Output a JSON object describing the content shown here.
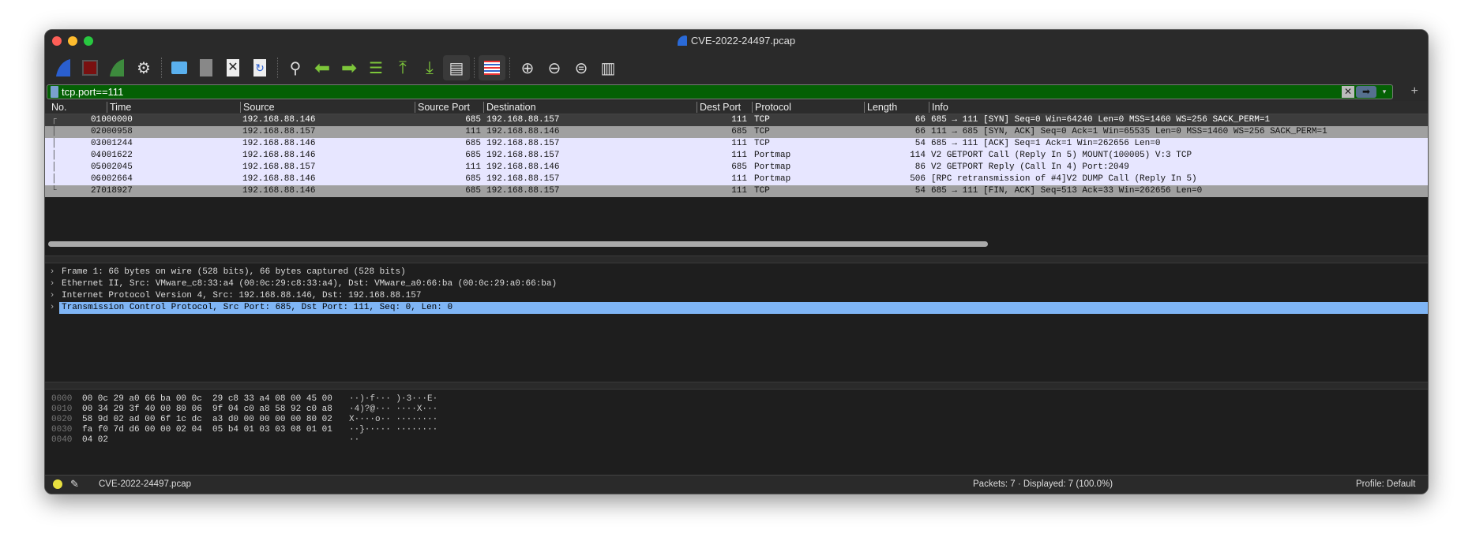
{
  "window": {
    "title": "CVE-2022-24497.pcap"
  },
  "toolbar": [
    "start-capture",
    "stop-capture",
    "restart-capture",
    "capture-options",
    "open-file",
    "save-file",
    "close-file",
    "reload-file",
    "find-packet",
    "go-back",
    "go-forward",
    "go-to-packet",
    "go-first",
    "go-last",
    "autoscroll",
    "colorize",
    "zoom-in",
    "zoom-out",
    "zoom-normal",
    "resize-columns"
  ],
  "filter": {
    "value": "tcp.port==111",
    "clear": "✕",
    "apply": "➡",
    "dropdown": "▾",
    "add": "+"
  },
  "columns": [
    "No.",
    "Time",
    "Source",
    "Source Port",
    "Destination",
    "Dest Port",
    "Protocol",
    "Length",
    "Info"
  ],
  "packets": [
    {
      "no": "1",
      "time": "0.000000",
      "src": "192.168.88.146",
      "sport": "685",
      "dst": "192.168.88.157",
      "dport": "111",
      "proto": "TCP",
      "len": "66",
      "info": "685 → 111 [SYN] Seq=0 Win=64240 Len=0 MSS=1460 WS=256 SACK_PERM=1"
    },
    {
      "no": "2",
      "time": "0.000958",
      "src": "192.168.88.157",
      "sport": "111",
      "dst": "192.168.88.146",
      "dport": "685",
      "proto": "TCP",
      "len": "66",
      "info": "111 → 685 [SYN, ACK] Seq=0 Ack=1 Win=65535 Len=0 MSS=1460 WS=256 SACK_PERM=1"
    },
    {
      "no": "3",
      "time": "0.001244",
      "src": "192.168.88.146",
      "sport": "685",
      "dst": "192.168.88.157",
      "dport": "111",
      "proto": "TCP",
      "len": "54",
      "info": "685 → 111 [ACK] Seq=1 Ack=1 Win=262656 Len=0"
    },
    {
      "no": "4",
      "time": "0.001622",
      "src": "192.168.88.146",
      "sport": "685",
      "dst": "192.168.88.157",
      "dport": "111",
      "proto": "Portmap",
      "len": "114",
      "info": "V2 GETPORT Call (Reply In 5) MOUNT(100005) V:3 TCP"
    },
    {
      "no": "5",
      "time": "0.002045",
      "src": "192.168.88.157",
      "sport": "111",
      "dst": "192.168.88.146",
      "dport": "685",
      "proto": "Portmap",
      "len": "86",
      "info": "V2 GETPORT Reply (Call In 4) Port:2049"
    },
    {
      "no": "6",
      "time": "0.002664",
      "src": "192.168.88.146",
      "sport": "685",
      "dst": "192.168.88.157",
      "dport": "111",
      "proto": "Portmap",
      "len": "506",
      "info": "[RPC retransmission of #4]V2 DUMP Call (Reply In 5)"
    },
    {
      "no": "7",
      "time": "2.018927",
      "src": "192.168.88.146",
      "sport": "685",
      "dst": "192.168.88.157",
      "dport": "111",
      "proto": "TCP",
      "len": "54",
      "info": "685 → 111 [FIN, ACK] Seq=513 Ack=33 Win=262656 Len=0"
    }
  ],
  "details": [
    "Frame 1: 66 bytes on wire (528 bits), 66 bytes captured (528 bits)",
    "Ethernet II, Src: VMware_c8:33:a4 (00:0c:29:c8:33:a4), Dst: VMware_a0:66:ba (00:0c:29:a0:66:ba)",
    "Internet Protocol Version 4, Src: 192.168.88.146, Dst: 192.168.88.157",
    "Transmission Control Protocol, Src Port: 685, Dst Port: 111, Seq: 0, Len: 0"
  ],
  "hex": [
    {
      "off": "0000",
      "bytes": "00 0c 29 a0 66 ba 00 0c  29 c8 33 a4 08 00 45 00",
      "ascii": "··)·f··· )·3···E·"
    },
    {
      "off": "0010",
      "bytes": "00 34 29 3f 40 00 80 06  9f 04 c0 a8 58 92 c0 a8",
      "ascii": "·4)?@··· ····X···"
    },
    {
      "off": "0020",
      "bytes": "58 9d 02 ad 00 6f 1c dc  a3 d0 00 00 00 00 80 02",
      "ascii": "X····o·· ········"
    },
    {
      "off": "0030",
      "bytes": "fa f0 7d d6 00 00 02 04  05 b4 01 03 03 08 01 01",
      "ascii": "··}····· ········"
    },
    {
      "off": "0040",
      "bytes": "04 02",
      "ascii": "··"
    }
  ],
  "status": {
    "file": "CVE-2022-24497.pcap",
    "packets": "Packets: 7 · Displayed: 7 (100.0%)",
    "profile": "Profile: Default"
  },
  "colors": {
    "selected": "#3d3d3d",
    "tcp_flags": "#a0a0a0",
    "tcp": "#e7e6ff",
    "detail_selected": "#7fb5f5",
    "filter_ok": "#046004"
  }
}
